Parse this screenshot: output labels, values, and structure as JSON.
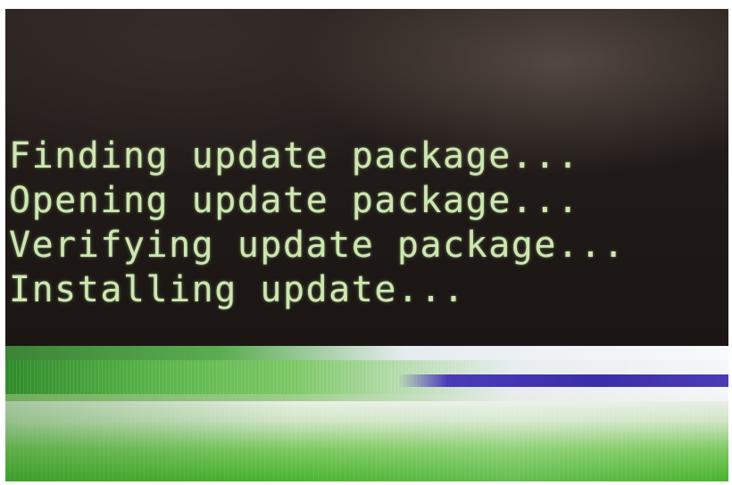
{
  "console": {
    "lines": [
      "Finding update package...",
      "Opening update package...",
      "Verifying update package...",
      "Installing update..."
    ]
  },
  "colors": {
    "text": "#cfe6b3",
    "background": "#1f1917",
    "glitch_green": "#47b22e",
    "glitch_purple": "#3a2ea8"
  }
}
